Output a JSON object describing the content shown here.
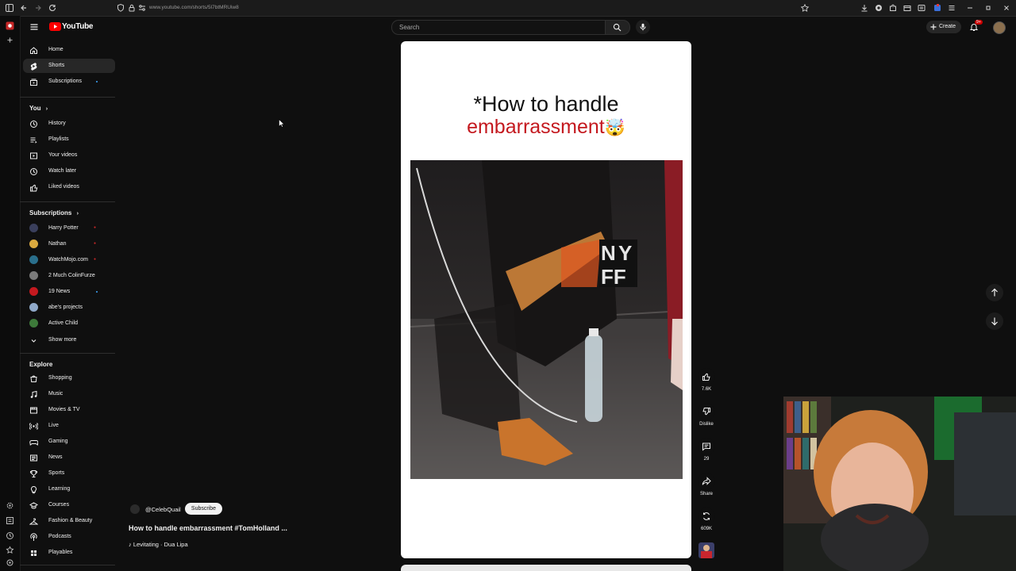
{
  "browser": {
    "url": "www.youtube.com/shorts/5l7btMRUiw8"
  },
  "header": {
    "logo_text": "YouTube",
    "search_placeholder": "Search",
    "create_label": "Create",
    "notification_count": "9+"
  },
  "sidebar": {
    "main": [
      {
        "label": "Home",
        "icon": "home-icon"
      },
      {
        "label": "Shorts",
        "icon": "shorts-icon",
        "active": true
      },
      {
        "label": "Subscriptions",
        "icon": "subscriptions-icon"
      }
    ],
    "you_title": "You",
    "you_items": [
      {
        "label": "History",
        "icon": "history-icon"
      },
      {
        "label": "Playlists",
        "icon": "playlists-icon"
      },
      {
        "label": "Your videos",
        "icon": "your-videos-icon"
      },
      {
        "label": "Watch later",
        "icon": "watch-later-icon"
      },
      {
        "label": "Liked videos",
        "icon": "liked-videos-icon"
      }
    ],
    "subs_title": "Subscriptions",
    "subs_items": [
      {
        "label": "Harry Potter",
        "avatar_color": "#3a3f5c"
      },
      {
        "label": "Nathan",
        "avatar_color": "#d9a93f"
      },
      {
        "label": "WatchMojo.com",
        "avatar_color": "#2a6f8c"
      },
      {
        "label": "2 Much ColinFurze",
        "avatar_color": "#7a7a7a"
      },
      {
        "label": "19 News",
        "avatar_color": "#c4191f"
      },
      {
        "label": "abe's projects",
        "avatar_color": "#8fa8c8"
      },
      {
        "label": "Active Child",
        "avatar_color": "#3d7a3a"
      }
    ],
    "show_more": "Show more",
    "explore_title": "Explore",
    "explore_items": [
      {
        "label": "Shopping",
        "icon": "shopping-icon"
      },
      {
        "label": "Music",
        "icon": "music-icon"
      },
      {
        "label": "Movies & TV",
        "icon": "movies-icon"
      },
      {
        "label": "Live",
        "icon": "live-icon"
      },
      {
        "label": "Gaming",
        "icon": "gaming-icon"
      },
      {
        "label": "News",
        "icon": "news-icon"
      },
      {
        "label": "Sports",
        "icon": "sports-icon"
      },
      {
        "label": "Learning",
        "icon": "learning-icon"
      },
      {
        "label": "Courses",
        "icon": "courses-icon"
      },
      {
        "label": "Fashion & Beauty",
        "icon": "fashion-icon"
      },
      {
        "label": "Podcasts",
        "icon": "podcasts-icon"
      },
      {
        "label": "Playables",
        "icon": "playables-icon"
      }
    ]
  },
  "short": {
    "caption_line1": "*How to handle",
    "caption_line2": "embarrassment",
    "caption_emoji": "🤯",
    "channel": "@CelebQuail",
    "subscribe_label": "Subscribe",
    "title": "How to handle embarrassment #TomHolland ...",
    "music": "Levitating · Dua Lipa"
  },
  "actions": {
    "likes": "7.6K",
    "dislike_label": "Dislike",
    "comments": "29",
    "share_label": "Share",
    "remix_count": "609K"
  },
  "colors": {
    "background": "#0f0f0f",
    "brand_red": "#ff0000",
    "caption_red": "#c4191f"
  }
}
